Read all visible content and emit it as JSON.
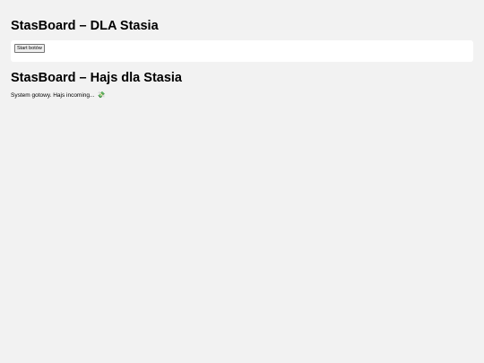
{
  "header": {
    "title": "StasBoard – DLA Stasia"
  },
  "controls": {
    "start_button_label": "Start botów"
  },
  "dashboard": {
    "title": "StasBoard – Hajs dla Stasia",
    "status_text": "System gotowy. Hajs incoming...",
    "status_icon": "money-with-wings-icon",
    "status_glyph": "💸"
  }
}
